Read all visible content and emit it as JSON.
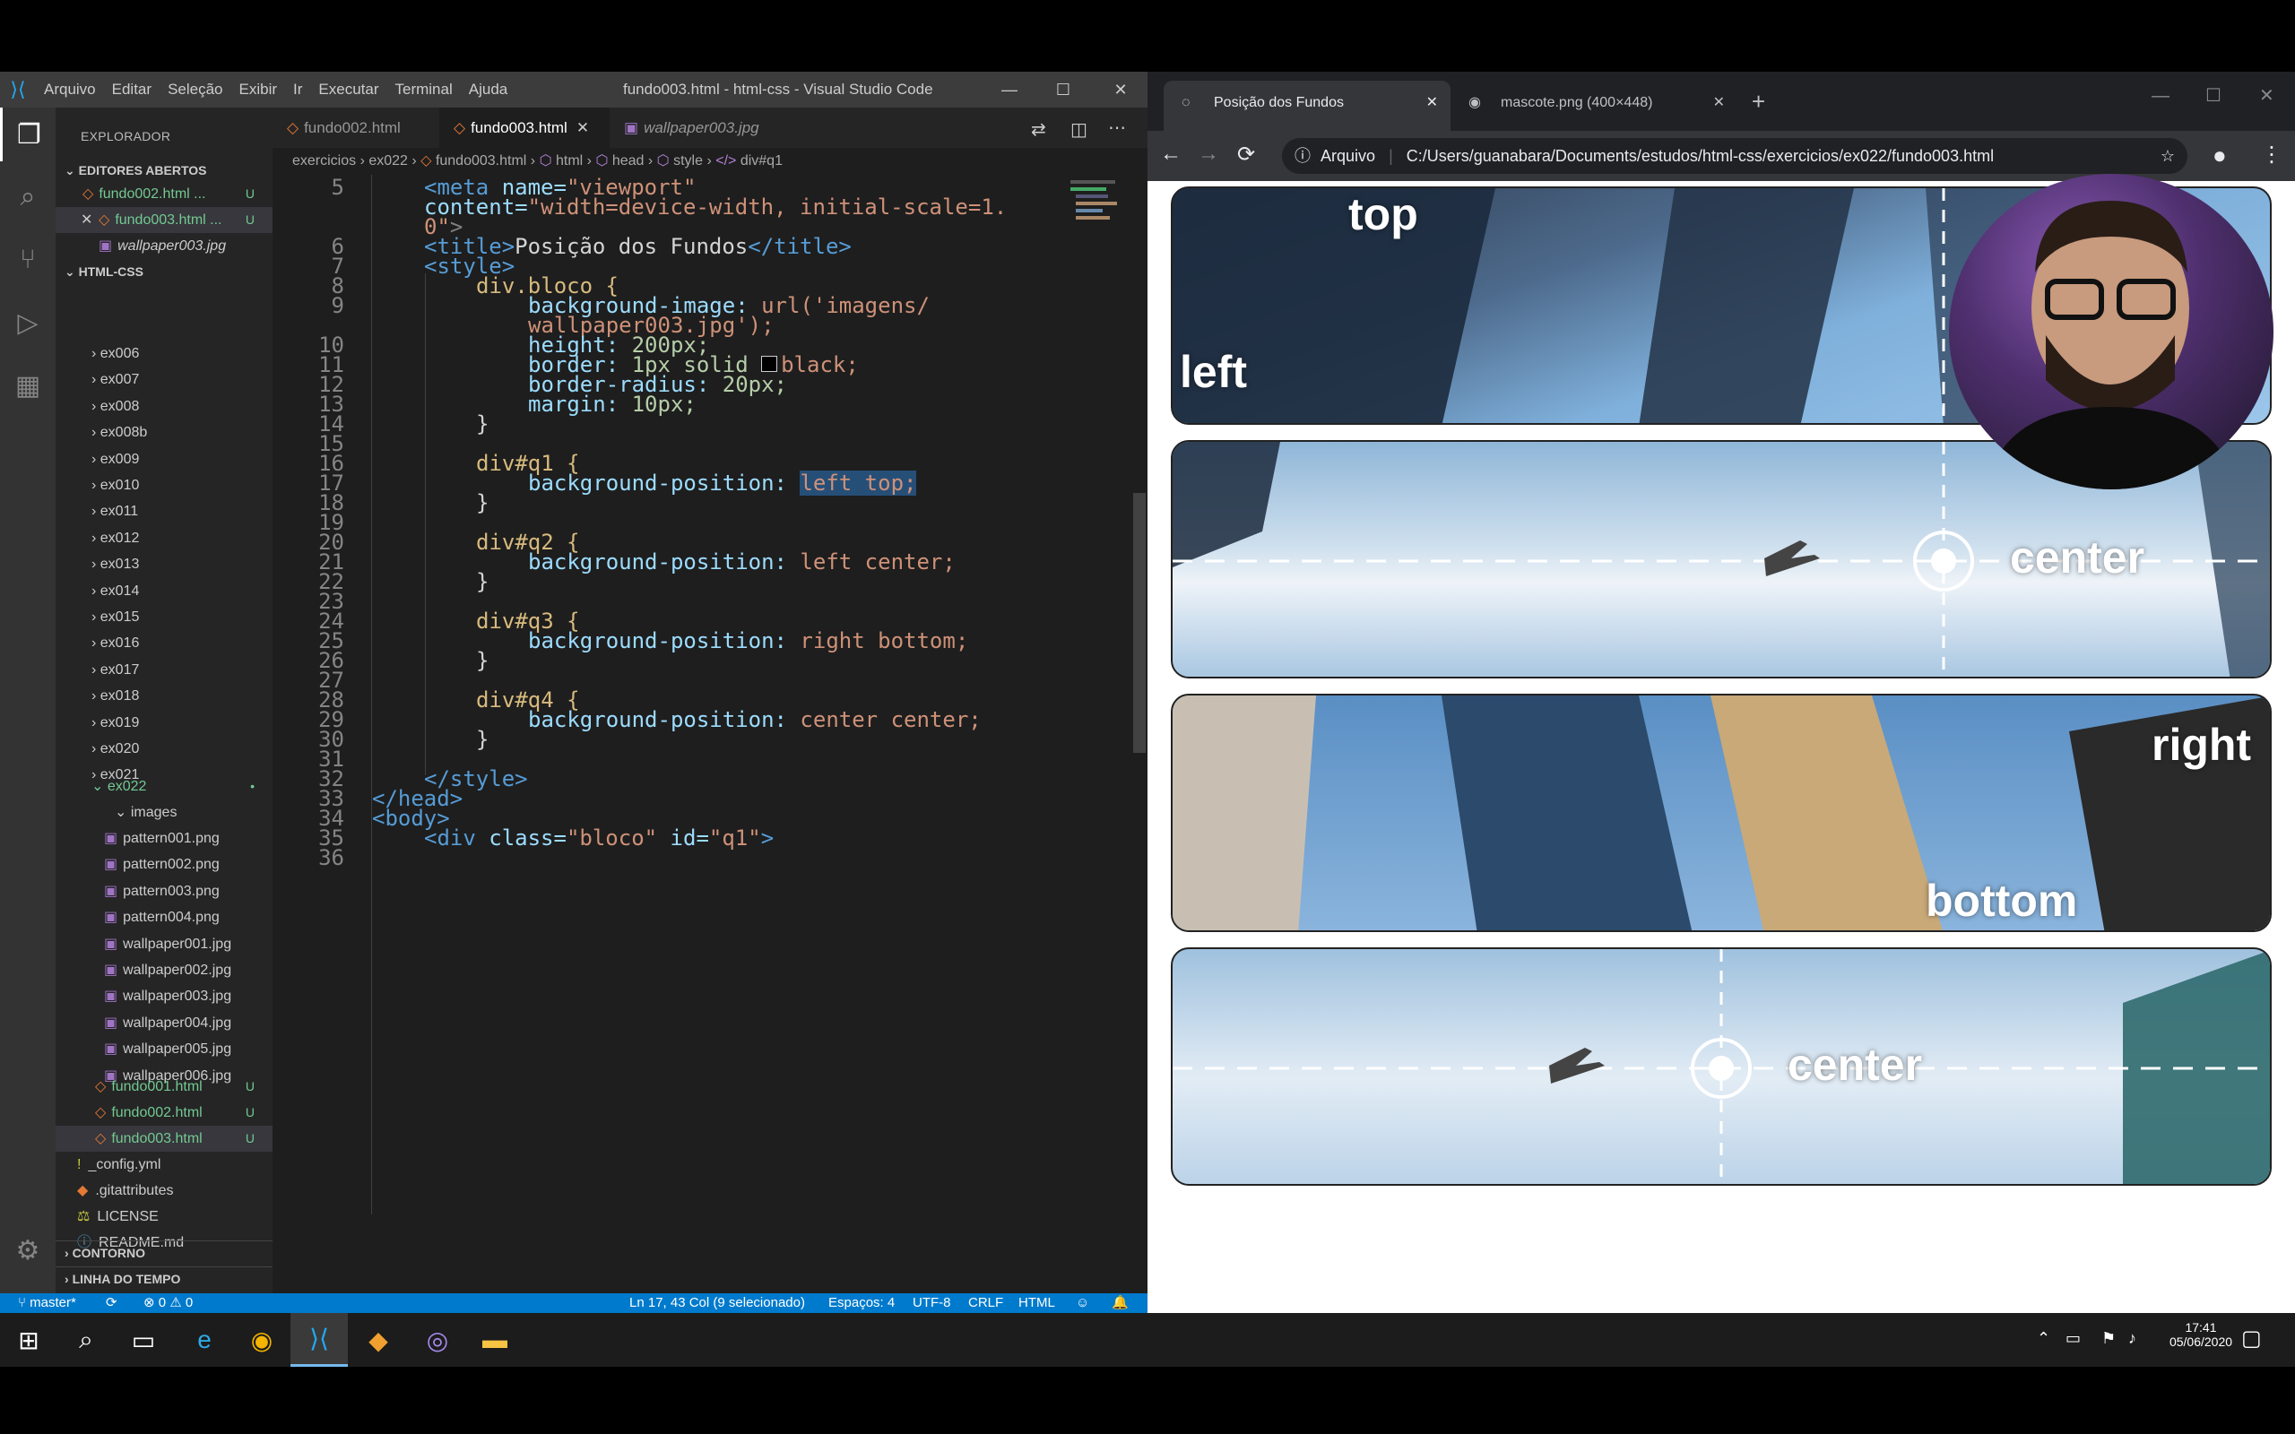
{
  "vscode": {
    "menu": [
      "Arquivo",
      "Editar",
      "Seleção",
      "Exibir",
      "Ir",
      "Executar",
      "Terminal",
      "Ajuda"
    ],
    "title": "fundo003.html - html-css - Visual Studio Code",
    "explorer_title": "EXPLORADOR",
    "open_editors_title": "EDITORES ABERTOS",
    "open_editors": [
      {
        "name": "fundo002.html ...",
        "badge": "U"
      },
      {
        "name": "fundo003.html ...",
        "badge": "U"
      },
      {
        "name": "wallpaper003.jpg",
        "badge": ""
      }
    ],
    "workspace_title": "HTML-CSS",
    "folders": [
      "ex006",
      "ex007",
      "ex008",
      "ex008b",
      "ex009",
      "ex010",
      "ex011",
      "ex012",
      "ex013",
      "ex014",
      "ex015",
      "ex016",
      "ex017",
      "ex018",
      "ex019",
      "ex020",
      "ex021"
    ],
    "ex022": "ex022",
    "images_folder": "images",
    "images": [
      "pattern001.png",
      "pattern002.png",
      "pattern003.png",
      "pattern004.png",
      "wallpaper001.jpg",
      "wallpaper002.jpg",
      "wallpaper003.jpg",
      "wallpaper004.jpg",
      "wallpaper005.jpg",
      "wallpaper006.jpg"
    ],
    "ex022_files": [
      {
        "name": "fundo001.html",
        "badge": "U"
      },
      {
        "name": "fundo002.html",
        "badge": "U"
      },
      {
        "name": "fundo003.html",
        "badge": "U"
      }
    ],
    "root_files": [
      "_config.yml",
      ".gitattributes",
      "LICENSE",
      "README.md"
    ],
    "outline_title": "CONTORNO",
    "timeline_title": "LINHA DO TEMPO",
    "tabs": [
      "fundo002.html",
      "fundo003.html",
      "wallpaper003.jpg"
    ],
    "breadcrumb": [
      "exercicios",
      "ex022",
      "fundo003.html",
      "html",
      "head",
      "style",
      "div#q1"
    ],
    "line_numbers": [
      "5",
      "",
      "",
      "6",
      "7",
      "8",
      "9",
      "",
      "10",
      "11",
      "12",
      "13",
      "14",
      "15",
      "16",
      "17",
      "18",
      "19",
      "20",
      "21",
      "22",
      "23",
      "24",
      "25",
      "26",
      "27",
      "28",
      "29",
      "30",
      "31",
      "32",
      "33",
      "34",
      "35",
      "36"
    ],
    "code": {
      "l5a_tag": "<meta",
      "l5a_attr": " name=",
      "l5a_val": "\"viewport\"",
      "l5b_attr": "content=",
      "l5b_val": "\"width=device-width, initial-scale=1.",
      "l5c_val": "0\"",
      "l5c_end": ">",
      "l6_open": "<title>",
      "l6_text": "Posição dos Fundos",
      "l6_close": "</title>",
      "l7": "<style>",
      "l8": "div.bloco {",
      "l9a_prop": "background-image:",
      "l9a_val": " url('imagens/",
      "l9b_val": "wallpaper003.jpg');",
      "l10_prop": "height:",
      "l10_val": " 200px;",
      "l11_prop": "border:",
      "l11_val1": " 1px solid ",
      "l11_val2": "black;",
      "l12_prop": "border-radius:",
      "l12_val": " 20px;",
      "l13_prop": "margin:",
      "l13_val": " 10px;",
      "close_brace": "}",
      "l16": "div#q1 {",
      "l17_prop": "background-position:",
      "l17_val": "left top;",
      "l20": "div#q2 {",
      "l21_prop": "background-position:",
      "l21_val": " left center;",
      "l24": "div#q3 {",
      "l25_prop": "background-position:",
      "l25_val": " right bottom;",
      "l28": "div#q4 {",
      "l29_prop": "background-position:",
      "l29_val": " center center;",
      "l32": "</style>",
      "l33": "</head>",
      "l34": "<body>",
      "l35_tag": "<div",
      "l35_attr1": " class=",
      "l35_val1": "\"bloco\"",
      "l35_attr2": " id=",
      "l35_val2": "\"q1\"",
      "l35_end": ">"
    },
    "status": {
      "branch": "master*",
      "problems": "⊗ 0 ⚠ 0",
      "position": "Ln 17, 43 Col (9 selecionado)",
      "spaces": "Espaços: 4",
      "encoding": "UTF-8",
      "eol": "CRLF",
      "language": "HTML"
    }
  },
  "chrome": {
    "tabs": [
      "Posição dos Fundos",
      "mascote.png (400×448)"
    ],
    "security": "Arquivo",
    "url": "C:/Users/guanabara/Documents/estudos/html-css/exercicios/ex022/fundo003.html",
    "labels": {
      "q1_top": "top",
      "q1_left": "left",
      "q2_center": "center",
      "q3_right": "right",
      "q3_bottom": "bottom",
      "q4_center": "center"
    }
  },
  "taskbar": {
    "time": "17:41",
    "date": "05/06/2020"
  },
  "colors": {
    "vscode_bg": "#1e1e1e",
    "statusbar": "#007acc",
    "selection": "#264f78"
  }
}
